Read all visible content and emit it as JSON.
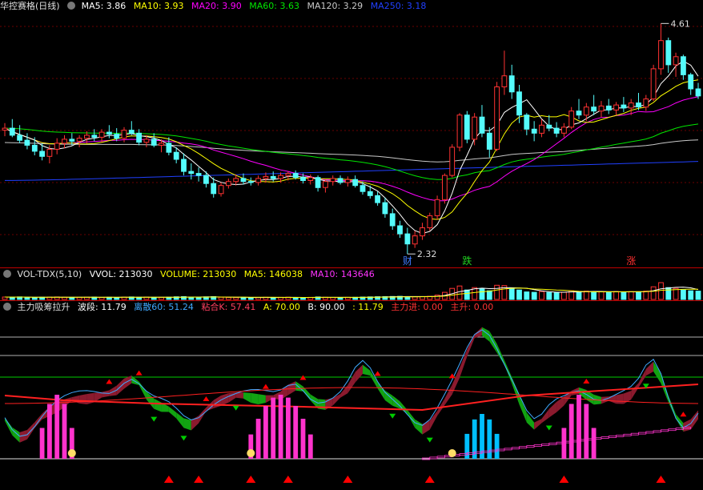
{
  "header": {
    "title": "华控赛格(日线)",
    "ma5": "MA5: 3.86",
    "ma10": "MA10: 3.93",
    "ma20": "MA20: 3.90",
    "ma60": "MA60: 3.63",
    "ma120": "MA120: 3.29",
    "ma250": "MA250: 3.18"
  },
  "volume_legend": {
    "name": "VOL-TDX(5,10)",
    "vvol": "VVOL: 213030",
    "volume": "VOLUME: 213030",
    "ma5": "MA5: 146038",
    "ma10": "MA10: 143646"
  },
  "indicator_legend": {
    "name": "主力吸筹拉升",
    "bo": "波段: 11.79",
    "li": "离散60: 51.24",
    "zhan": "粘合K: 57.41",
    "a": "A: 70.00",
    "b": "B: 90.00",
    "c": ": 11.79",
    "zj": "主力进: 0.00",
    "zs": "主升: 0.00"
  },
  "colors": {
    "up": "#ff3232",
    "down": "#54fcfc",
    "ma5": "#ffffff",
    "ma10": "#ffff00",
    "ma20": "#ff00ff",
    "ma60": "#00e600",
    "ma250": "#2040ff",
    "magenta": "#ff33cc",
    "wave": "#8b1a2e",
    "green": "#12a312",
    "up_arrow": "#ff0000",
    "down_arrow": "#00cc00"
  },
  "chart_data": [
    {
      "type": "candlestick",
      "price_annotations": {
        "high": "4.61",
        "low": "2.32"
      },
      "markers": [
        {
          "label": "财",
          "index": 54
        },
        {
          "label": "跌",
          "index": 62
        },
        {
          "label": "涨",
          "index": 84
        }
      ],
      "ohlc": [
        [
          3.55,
          3.62,
          3.49,
          3.57
        ],
        [
          3.57,
          3.66,
          3.48,
          3.5
        ],
        [
          3.5,
          3.6,
          3.42,
          3.45
        ],
        [
          3.45,
          3.52,
          3.36,
          3.4
        ],
        [
          3.4,
          3.48,
          3.3,
          3.34
        ],
        [
          3.34,
          3.42,
          3.25,
          3.29
        ],
        [
          3.29,
          3.4,
          3.22,
          3.36
        ],
        [
          3.36,
          3.47,
          3.31,
          3.42
        ],
        [
          3.42,
          3.5,
          3.37,
          3.46
        ],
        [
          3.46,
          3.52,
          3.4,
          3.44
        ],
        [
          3.44,
          3.5,
          3.38,
          3.47
        ],
        [
          3.47,
          3.54,
          3.42,
          3.5
        ],
        [
          3.5,
          3.56,
          3.44,
          3.48
        ],
        [
          3.48,
          3.56,
          3.43,
          3.53
        ],
        [
          3.53,
          3.6,
          3.47,
          3.51
        ],
        [
          3.51,
          3.57,
          3.44,
          3.47
        ],
        [
          3.47,
          3.58,
          3.43,
          3.55
        ],
        [
          3.55,
          3.64,
          3.5,
          3.52
        ],
        [
          3.52,
          3.56,
          3.4,
          3.43
        ],
        [
          3.43,
          3.5,
          3.38,
          3.46
        ],
        [
          3.46,
          3.52,
          3.38,
          3.4
        ],
        [
          3.4,
          3.46,
          3.33,
          3.42
        ],
        [
          3.42,
          3.48,
          3.3,
          3.33
        ],
        [
          3.33,
          3.38,
          3.22,
          3.26
        ],
        [
          3.26,
          3.32,
          3.1,
          3.14
        ],
        [
          3.14,
          3.22,
          3.06,
          3.12
        ],
        [
          3.12,
          3.18,
          3.04,
          3.1
        ],
        [
          3.1,
          3.14,
          2.98,
          3.02
        ],
        [
          3.02,
          3.08,
          2.88,
          2.92
        ],
        [
          2.92,
          3.03,
          2.89,
          3.0
        ],
        [
          3.0,
          3.07,
          2.97,
          3.04
        ],
        [
          3.04,
          3.11,
          3.0,
          3.07
        ],
        [
          3.07,
          3.12,
          3.01,
          3.04
        ],
        [
          3.04,
          3.08,
          3.0,
          3.03
        ],
        [
          3.03,
          3.1,
          3.0,
          3.07
        ],
        [
          3.07,
          3.13,
          3.03,
          3.09
        ],
        [
          3.09,
          3.14,
          3.04,
          3.07
        ],
        [
          3.07,
          3.13,
          3.03,
          3.1
        ],
        [
          3.1,
          3.14,
          3.05,
          3.12
        ],
        [
          3.12,
          3.15,
          3.06,
          3.08
        ],
        [
          3.08,
          3.12,
          3.02,
          3.05
        ],
        [
          3.05,
          3.11,
          3.01,
          3.08
        ],
        [
          3.08,
          3.1,
          2.94,
          2.98
        ],
        [
          2.98,
          3.06,
          2.93,
          3.04
        ],
        [
          3.04,
          3.1,
          3.0,
          3.07
        ],
        [
          3.07,
          3.1,
          3.01,
          3.03
        ],
        [
          3.03,
          3.09,
          2.99,
          3.06
        ],
        [
          3.06,
          3.1,
          2.98,
          3.0
        ],
        [
          3.0,
          3.04,
          2.91,
          2.94
        ],
        [
          2.94,
          3.0,
          2.87,
          2.9
        ],
        [
          2.9,
          2.94,
          2.8,
          2.83
        ],
        [
          2.83,
          2.88,
          2.68,
          2.72
        ],
        [
          2.72,
          2.77,
          2.56,
          2.6
        ],
        [
          2.6,
          2.65,
          2.48,
          2.52
        ],
        [
          2.52,
          2.58,
          2.32,
          2.42
        ],
        [
          2.42,
          2.55,
          2.38,
          2.5
        ],
        [
          2.5,
          2.63,
          2.46,
          2.58
        ],
        [
          2.58,
          2.73,
          2.55,
          2.7
        ],
        [
          2.7,
          2.9,
          2.66,
          2.86
        ],
        [
          2.86,
          3.12,
          2.82,
          3.1
        ],
        [
          3.1,
          3.41,
          3.08,
          3.38
        ],
        [
          3.38,
          3.72,
          3.34,
          3.7
        ],
        [
          3.7,
          3.74,
          3.42,
          3.46
        ],
        [
          3.46,
          3.72,
          3.4,
          3.68
        ],
        [
          3.68,
          3.8,
          3.48,
          3.52
        ],
        [
          3.52,
          3.58,
          3.28,
          3.36
        ],
        [
          3.36,
          4.03,
          3.34,
          3.98
        ],
        [
          3.98,
          4.34,
          3.9,
          4.09
        ],
        [
          4.09,
          4.2,
          3.86,
          3.93
        ],
        [
          3.93,
          4.0,
          3.62,
          3.7
        ],
        [
          3.7,
          3.72,
          3.5,
          3.56
        ],
        [
          3.56,
          3.64,
          3.44,
          3.52
        ],
        [
          3.52,
          3.66,
          3.48,
          3.6
        ],
        [
          3.6,
          3.7,
          3.54,
          3.57
        ],
        [
          3.57,
          3.63,
          3.48,
          3.52
        ],
        [
          3.52,
          3.62,
          3.48,
          3.58
        ],
        [
          3.58,
          3.78,
          3.56,
          3.74
        ],
        [
          3.74,
          3.86,
          3.66,
          3.7
        ],
        [
          3.7,
          3.82,
          3.64,
          3.78
        ],
        [
          3.78,
          3.9,
          3.7,
          3.74
        ],
        [
          3.74,
          3.84,
          3.68,
          3.79
        ],
        [
          3.79,
          3.86,
          3.71,
          3.75
        ],
        [
          3.75,
          3.83,
          3.7,
          3.8
        ],
        [
          3.8,
          3.88,
          3.73,
          3.77
        ],
        [
          3.77,
          3.86,
          3.7,
          3.82
        ],
        [
          3.82,
          3.92,
          3.75,
          3.78
        ],
        [
          3.78,
          3.9,
          3.74,
          3.86
        ],
        [
          3.86,
          4.2,
          3.84,
          4.16
        ],
        [
          4.16,
          4.61,
          4.1,
          4.44
        ],
        [
          4.44,
          4.47,
          4.12,
          4.2
        ],
        [
          4.2,
          4.32,
          4.08,
          4.28
        ],
        [
          4.28,
          4.3,
          4.05,
          4.1
        ],
        [
          4.1,
          4.12,
          3.9,
          3.96
        ],
        [
          3.96,
          4.02,
          3.86,
          3.89
        ]
      ]
    },
    {
      "type": "bar",
      "series": [
        {
          "name": "VOLUME",
          "values": [
            30,
            28,
            32,
            26,
            25,
            27,
            29,
            31,
            27,
            24,
            26,
            28,
            30,
            25,
            27,
            24,
            29,
            31,
            27,
            30,
            26,
            25,
            28,
            33,
            35,
            30,
            28,
            32,
            36,
            27,
            25,
            24,
            26,
            23,
            25,
            27,
            24,
            26,
            28,
            25,
            24,
            26,
            31,
            27,
            25,
            24,
            26,
            27,
            30,
            32,
            34,
            36,
            38,
            40,
            35,
            33,
            36,
            40,
            55,
            90,
            140,
            170,
            120,
            150,
            135,
            110,
            180,
            175,
            140,
            120,
            95,
            90,
            100,
            88,
            85,
            92,
            110,
            100,
            105,
            98,
            96,
            92,
            100,
            95,
            98,
            97,
            105,
            160,
            213,
            150,
            140,
            120,
            110,
            105
          ]
        }
      ]
    }
  ]
}
